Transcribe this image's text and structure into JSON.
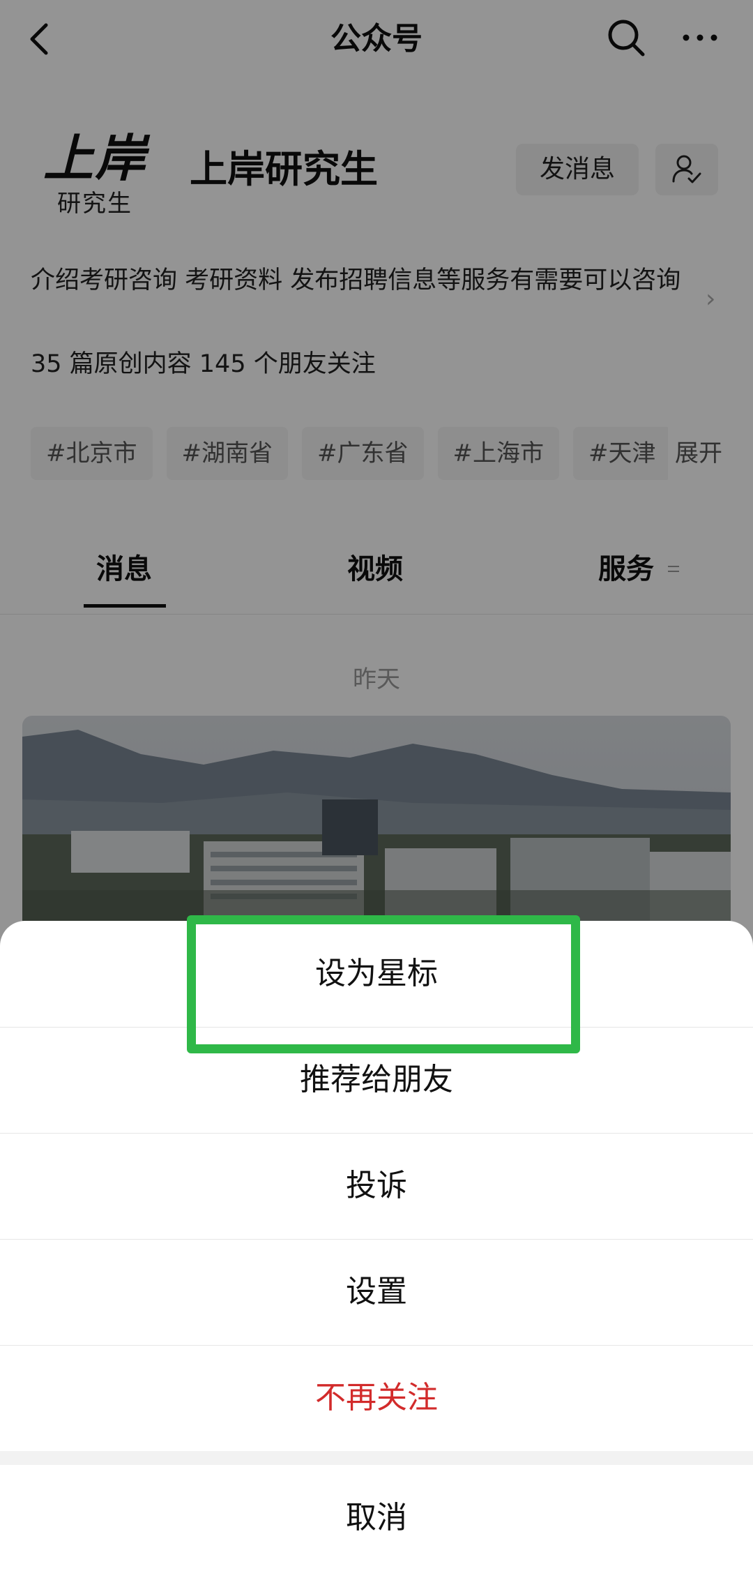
{
  "nav": {
    "title": "公众号"
  },
  "account": {
    "logo_big": "上岸",
    "logo_small": "研究生",
    "name": "上岸研究生",
    "send_message_label": "发消息",
    "description": "介绍考研咨询 考研资料 发布招聘信息等服务有需要可以咨询",
    "stats": "35 篇原创内容  145 个朋友关注"
  },
  "tags": [
    "#北京市",
    "#湖南省",
    "#广东省",
    "#上海市",
    "#天津"
  ],
  "expand_label": "展开",
  "tabs": {
    "messages": "消息",
    "videos": "视频",
    "services": "服务"
  },
  "feed": {
    "day_label": "昨天"
  },
  "action_sheet": {
    "items": [
      "设为星标",
      "推荐给朋友",
      "投诉",
      "设置",
      "不再关注"
    ],
    "cancel": "取消",
    "danger_color": "#d22b2b"
  },
  "highlight_color": "#2fb848",
  "watermark": "上岸研究生"
}
